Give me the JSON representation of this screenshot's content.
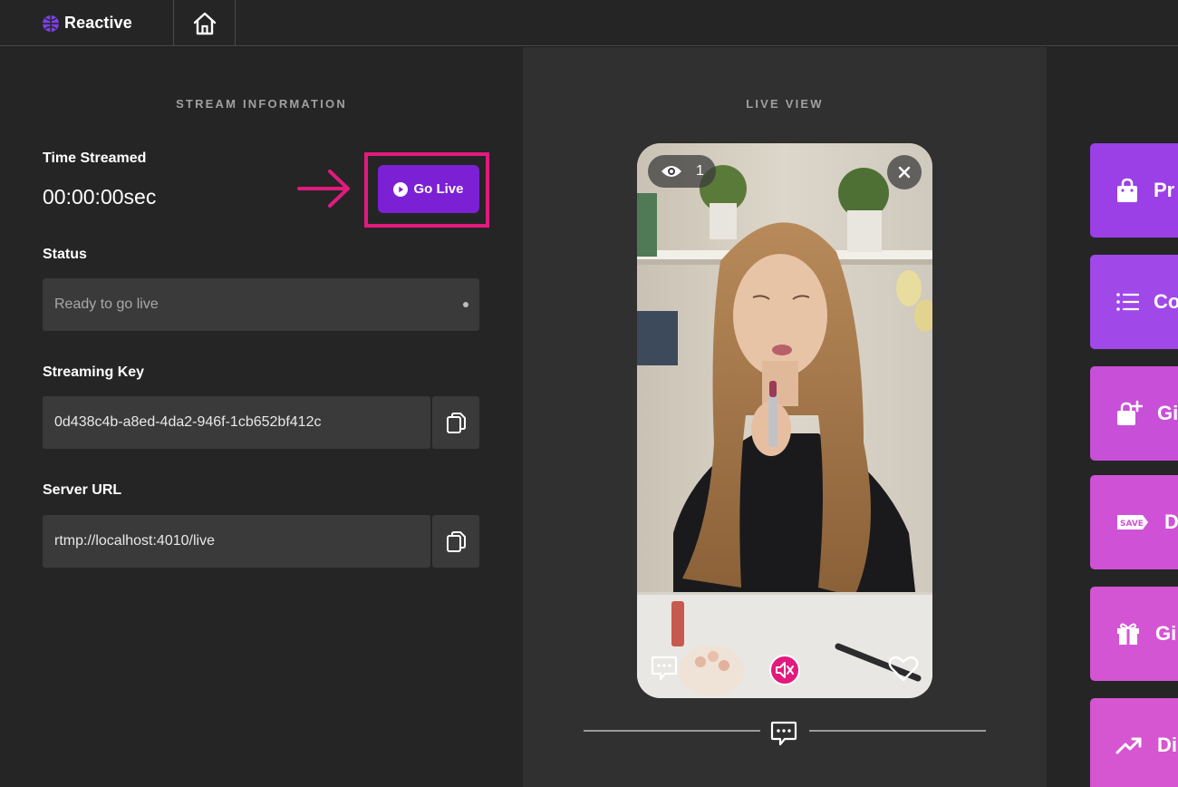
{
  "app": {
    "brand": "Reactive"
  },
  "stream_info": {
    "title": "STREAM INFORMATION",
    "time_label": "Time Streamed",
    "time_value": "00:00:00sec",
    "go_live_label": "Go Live",
    "status_label": "Status",
    "status_value": "Ready to go live",
    "key_label": "Streaming Key",
    "key_value": "0d438c4b-a8ed-4da2-946f-1cb652bf412c",
    "url_label": "Server URL",
    "url_value": "rtmp://localhost:4010/live"
  },
  "live_view": {
    "title": "LIVE VIEW",
    "viewer_count": "1"
  },
  "actions": [
    {
      "label": "Pr",
      "icon": "shopping-bag-icon",
      "color": "#9b3fe6"
    },
    {
      "label": "Co",
      "icon": "list-icon",
      "color": "#a048e8"
    },
    {
      "label": "Gi",
      "icon": "gift-add-icon",
      "color": "#c850d8"
    },
    {
      "label": "Di",
      "icon": "save-tag-icon",
      "color": "#cf52d6"
    },
    {
      "label": "Gi",
      "icon": "gift-icon",
      "color": "#d455d4"
    },
    {
      "label": "Di",
      "icon": "trending-up-icon",
      "color": "#d656d2"
    }
  ],
  "colors": {
    "accent": "#7b20d4",
    "highlight": "#e21a7d"
  }
}
